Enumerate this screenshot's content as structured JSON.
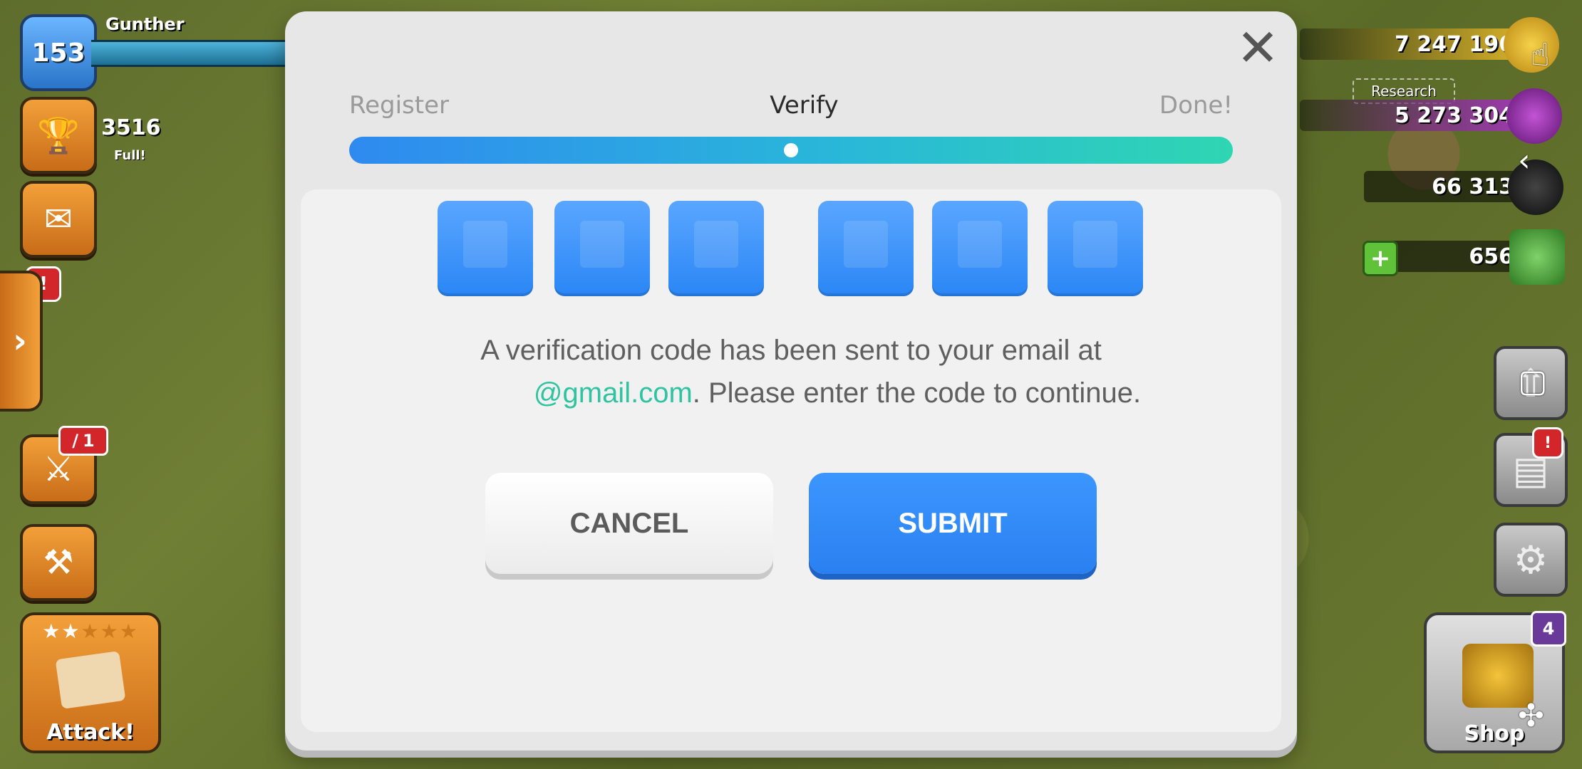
{
  "hud": {
    "player_level": "153",
    "player_name": "Gunther",
    "trophies": "3516",
    "full_label": "Full!",
    "alert_mark": "!",
    "side_tab_arrow": "›",
    "war_sword_count": "1",
    "attack_stars": {
      "filled": 2,
      "total": 5
    },
    "attack_label": "Attack!",
    "shop_label": "Shop",
    "shop_badge": "4"
  },
  "resources": {
    "gold": "7 247 196",
    "elixir": "5 273 304",
    "dark_elixir": "66 313",
    "gems": "656",
    "research_label": "Research"
  },
  "modal": {
    "steps": [
      {
        "label": "Register"
      },
      {
        "label": "Verify"
      },
      {
        "label": "Done!"
      }
    ],
    "progress": 0.5,
    "code_boxes": [
      "",
      "",
      "",
      "",
      "",
      ""
    ],
    "message_line1": "A verification code has been sent to your email at",
    "message_email": "@gmail.com",
    "message_line2": ". Please enter the code to continue.",
    "cancel_label": "CANCEL",
    "submit_label": "SUBMIT",
    "close_symbol": "✕"
  },
  "colors": {
    "accent_blue": "#2a86f5",
    "email_teal": "#2fc3a1",
    "modal_bg": "#e7e7e7"
  }
}
